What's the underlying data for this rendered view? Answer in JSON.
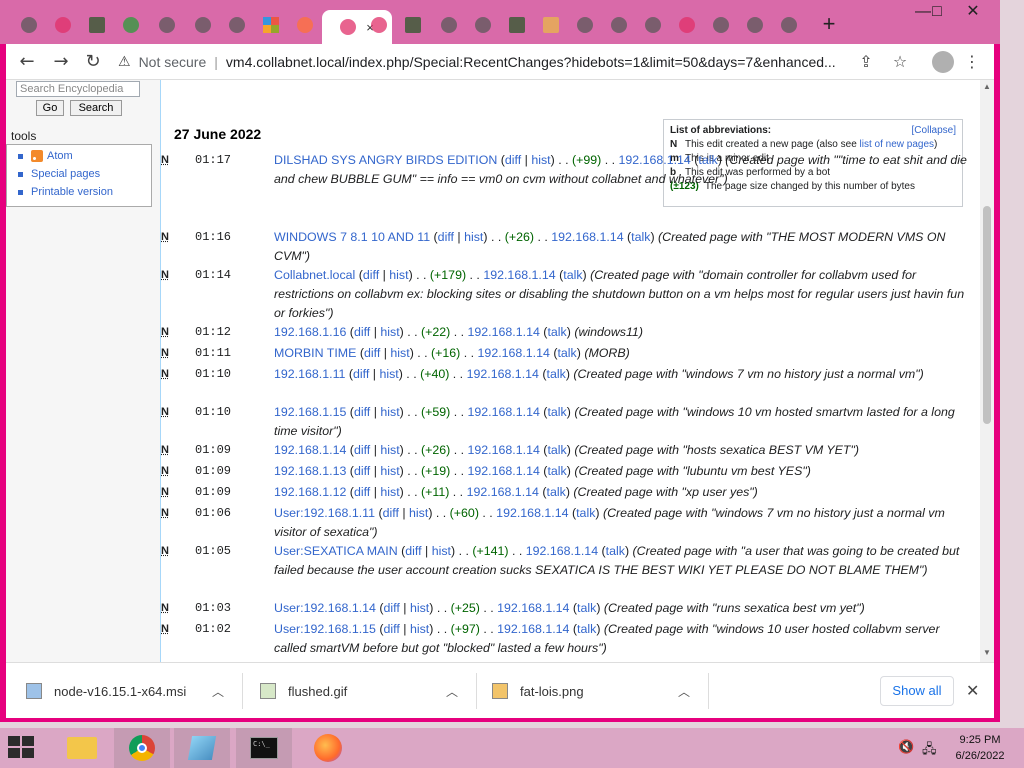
{
  "browser": {
    "tabs_count": 22,
    "active_tab_close": "×",
    "new_tab": "+",
    "window_controls": [
      "—",
      "□",
      "✕"
    ],
    "nav": {
      "back": "←",
      "forward": "→",
      "reload": "↻"
    },
    "security_label": "Not secure",
    "url": "vm4.collabnet.local/index.php/Special:RecentChanges?hidebots=1&limit=50&days=7&enhanced..."
  },
  "sidebar": {
    "search_placeholder": "Search Encyclopedia",
    "go_label": "Go",
    "search_label": "Search",
    "tools_heading": "tools",
    "tools": [
      {
        "label": "Atom",
        "icon": "rss-icon"
      },
      {
        "label": "Special pages"
      },
      {
        "label": "Printable version"
      }
    ]
  },
  "main": {
    "date_heading": "27 June 2022",
    "abbrev": {
      "title": "List of abbreviations:",
      "collapse": "[Collapse]",
      "rows": [
        {
          "key": "N",
          "text": "This edit created a new page (also see ",
          "link": "list of new pages",
          "tail": ")"
        },
        {
          "key": "m",
          "text": "This is a minor edit"
        },
        {
          "key": "b",
          "text": "This edit was performed by a bot"
        },
        {
          "key": "(±123)",
          "text": "The page size changed by this number of bytes"
        }
      ]
    },
    "entries": [
      {
        "flag": "N",
        "time": "01:17",
        "page": "DILSHAD SYS ANGRY BIRDS EDITION",
        "size": "(+99)",
        "user": "192.168.1.14",
        "comment": "(Created page with \"\"time to eat shit and die and chew BUBBLE GUM\" == info == vm0 on cvm without collabnet and whatever\")"
      },
      {
        "flag": "N",
        "time": "01:16",
        "page": "WINDOWS 7 8.1 10 AND 11",
        "size": "(+26)",
        "user": "192.168.1.14",
        "comment": "(Created page with \"THE MOST MODERN VMS ON CVM\")"
      },
      {
        "flag": "N",
        "time": "01:14",
        "page": "Collabnet.local",
        "size": "(+179)",
        "user": "192.168.1.14",
        "comment": "(Created page with \"domain controller for collabvm used for restrictions on collabvm ex: blocking sites or disabling the shutdown button on a vm helps most for regular users just havin fun or forkies\")"
      },
      {
        "flag": "N",
        "time": "01:12",
        "page": "192.168.1.16",
        "size": "(+22)",
        "user": "192.168.1.14",
        "comment": "(windows11)"
      },
      {
        "flag": "N",
        "time": "01:11",
        "page": "MORBIN TIME",
        "size": "(+16)",
        "user": "192.168.1.14",
        "comment": "(MORB)"
      },
      {
        "flag": "N",
        "time": "01:10",
        "page": "192.168.1.11",
        "size": "(+40)",
        "user": "192.168.1.14",
        "comment": "(Created page with \"windows 7 vm no history just a normal vm\")"
      },
      {
        "flag": "N",
        "time": "01:10",
        "page": "192.168.1.15",
        "size": "(+59)",
        "user": "192.168.1.14",
        "comment": "(Created page with \"windows 10 vm hosted smartvm lasted for a long time visitor\")"
      },
      {
        "flag": "N",
        "time": "01:09",
        "page": "192.168.1.14",
        "size": "(+26)",
        "user": "192.168.1.14",
        "comment": "(Created page with \"hosts sexatica BEST VM YET\")"
      },
      {
        "flag": "N",
        "time": "01:09",
        "page": "192.168.1.13",
        "size": "(+19)",
        "user": "192.168.1.14",
        "comment": "(Created page with \"lubuntu vm best YES\")"
      },
      {
        "flag": "N",
        "time": "01:09",
        "page": "192.168.1.12",
        "size": "(+11)",
        "user": "192.168.1.14",
        "comment": "(Created page with \"xp user yes\")"
      },
      {
        "flag": "N",
        "time": "01:06",
        "page": "User:192.168.1.11",
        "size": "(+60)",
        "user": "192.168.1.14",
        "comment": "(Created page with \"windows 7 vm no history just a normal vm visitor of sexatica\")"
      },
      {
        "flag": "N",
        "time": "01:05",
        "page": "User:SEXATICA MAIN",
        "size": "(+141)",
        "user": "192.168.1.14",
        "comment": "(Created page with \"a user that was going to be created but failed because the user account creation sucks SEXATICA IS THE BEST WIKI YET PLEASE DO NOT BLAME THEM\")"
      },
      {
        "flag": "N",
        "time": "01:03",
        "page": "User:192.168.1.14",
        "size": "(+25)",
        "user": "192.168.1.14",
        "comment": "(Created page with \"runs sexatica best vm yet\")"
      },
      {
        "flag": "N",
        "time": "01:02",
        "page": "User:192.168.1.15",
        "size": "(+97)",
        "user": "192.168.1.14",
        "comment": "(Created page with \"windows 10 user hosted collabvm server called smartVM before but got \"blocked\" lasted a few hours\")"
      }
    ],
    "diff_label": "diff",
    "hist_label": "hist",
    "talk_label": "talk"
  },
  "downloads": {
    "items": [
      {
        "name": "node-v16.15.1-x64.msi"
      },
      {
        "name": "flushed.gif"
      },
      {
        "name": "fat-lois.png"
      }
    ],
    "show_all": "Show all",
    "close": "✕"
  },
  "taskbar": {
    "time": "9:25 PM",
    "date": "6/26/2022"
  }
}
